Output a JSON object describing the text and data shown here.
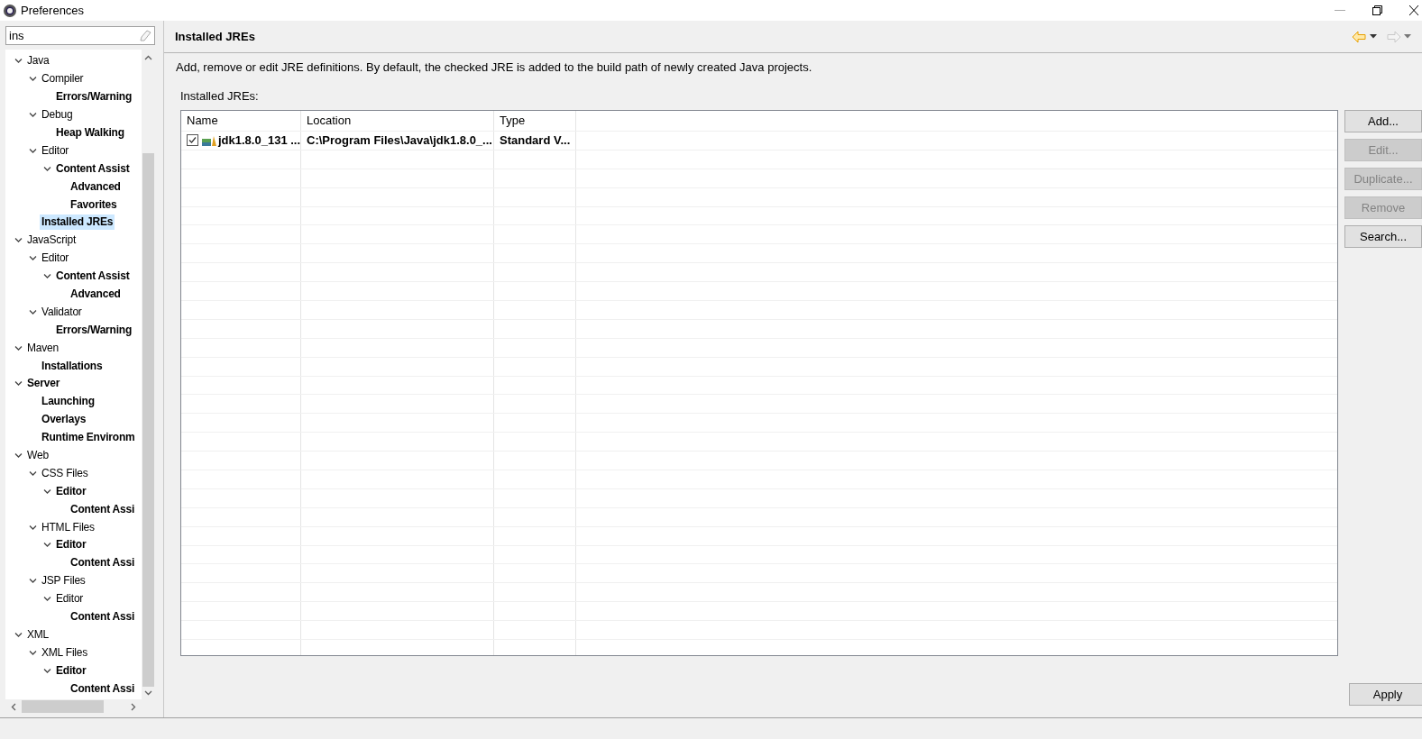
{
  "window": {
    "title": "Preferences"
  },
  "filter": {
    "value": "ins"
  },
  "tree": [
    {
      "label": "Java",
      "match": false,
      "expanded": true,
      "selected": false,
      "children": [
        {
          "label": "Compiler",
          "match": false,
          "expanded": true,
          "selected": false,
          "children": [
            {
              "label": "Errors/Warning",
              "match": true,
              "selected": false
            }
          ]
        },
        {
          "label": "Debug",
          "match": false,
          "expanded": true,
          "selected": false,
          "children": [
            {
              "label": "Heap Walking",
              "match": true,
              "selected": false
            }
          ]
        },
        {
          "label": "Editor",
          "match": false,
          "expanded": true,
          "selected": false,
          "children": [
            {
              "label": "Content Assist",
              "match": true,
              "expanded": true,
              "selected": false,
              "children": [
                {
                  "label": "Advanced",
                  "match": true,
                  "selected": false
                },
                {
                  "label": "Favorites",
                  "match": true,
                  "selected": false
                }
              ]
            }
          ]
        },
        {
          "label": "Installed JREs",
          "match": true,
          "selected": true
        }
      ]
    },
    {
      "label": "JavaScript",
      "match": false,
      "expanded": true,
      "selected": false,
      "children": [
        {
          "label": "Editor",
          "match": false,
          "expanded": true,
          "selected": false,
          "children": [
            {
              "label": "Content Assist",
              "match": true,
              "expanded": true,
              "selected": false,
              "children": [
                {
                  "label": "Advanced",
                  "match": true,
                  "selected": false
                }
              ]
            }
          ]
        },
        {
          "label": "Validator",
          "match": false,
          "expanded": true,
          "selected": false,
          "children": [
            {
              "label": "Errors/Warning",
              "match": true,
              "selected": false
            }
          ]
        }
      ]
    },
    {
      "label": "Maven",
      "match": false,
      "expanded": true,
      "selected": false,
      "children": [
        {
          "label": "Installations",
          "match": true,
          "selected": false
        }
      ]
    },
    {
      "label": "Server",
      "match": true,
      "expanded": true,
      "selected": false,
      "children": [
        {
          "label": "Launching",
          "match": true,
          "selected": false
        },
        {
          "label": "Overlays",
          "match": true,
          "selected": false
        },
        {
          "label": "Runtime Environm",
          "match": true,
          "selected": false
        }
      ]
    },
    {
      "label": "Web",
      "match": false,
      "expanded": true,
      "selected": false,
      "children": [
        {
          "label": "CSS Files",
          "match": false,
          "expanded": true,
          "selected": false,
          "children": [
            {
              "label": "Editor",
              "match": true,
              "expanded": true,
              "selected": false,
              "children": [
                {
                  "label": "Content Assi",
                  "match": true,
                  "selected": false
                }
              ]
            }
          ]
        },
        {
          "label": "HTML Files",
          "match": false,
          "expanded": true,
          "selected": false,
          "children": [
            {
              "label": "Editor",
              "match": true,
              "expanded": true,
              "selected": false,
              "children": [
                {
                  "label": "Content Assi",
                  "match": true,
                  "selected": false
                }
              ]
            }
          ]
        },
        {
          "label": "JSP Files",
          "match": false,
          "expanded": true,
          "selected": false,
          "children": [
            {
              "label": "Editor",
              "match": false,
              "expanded": true,
              "selected": false,
              "children": [
                {
                  "label": "Content Assi",
                  "match": true,
                  "selected": false
                }
              ]
            }
          ]
        }
      ]
    },
    {
      "label": "XML",
      "match": false,
      "expanded": true,
      "selected": false,
      "children": [
        {
          "label": "XML Files",
          "match": false,
          "expanded": true,
          "selected": false,
          "children": [
            {
              "label": "Editor",
              "match": true,
              "expanded": true,
              "selected": false,
              "children": [
                {
                  "label": "Content Assi",
                  "match": true,
                  "selected": false
                }
              ]
            }
          ]
        }
      ]
    }
  ],
  "page": {
    "title": "Installed JREs",
    "nav_buttons": [
      {
        "kind": "back",
        "disabled": false
      },
      {
        "kind": "forward",
        "disabled": true
      }
    ],
    "description": "Add, remove or edit JRE definitions. By default, the checked JRE is added to the build path of newly created Java projects.",
    "table_label": "Installed JREs:",
    "table": {
      "columns": [
        "Name",
        "Location",
        "Type"
      ],
      "rows": [
        {
          "checked": true,
          "cells": [
            "jdk1.8.0_131 ...",
            "C:\\Program Files\\Java\\jdk1.8.0_...",
            "Standard V..."
          ]
        }
      ]
    },
    "buttons": [
      {
        "label": "Add...",
        "disabled": false
      },
      {
        "label": "Edit...",
        "disabled": true
      },
      {
        "label": "Duplicate...",
        "disabled": true
      },
      {
        "label": "Remove",
        "disabled": true
      },
      {
        "label": "Search...",
        "disabled": false
      }
    ],
    "apply_button": {
      "label": "Apply"
    }
  }
}
